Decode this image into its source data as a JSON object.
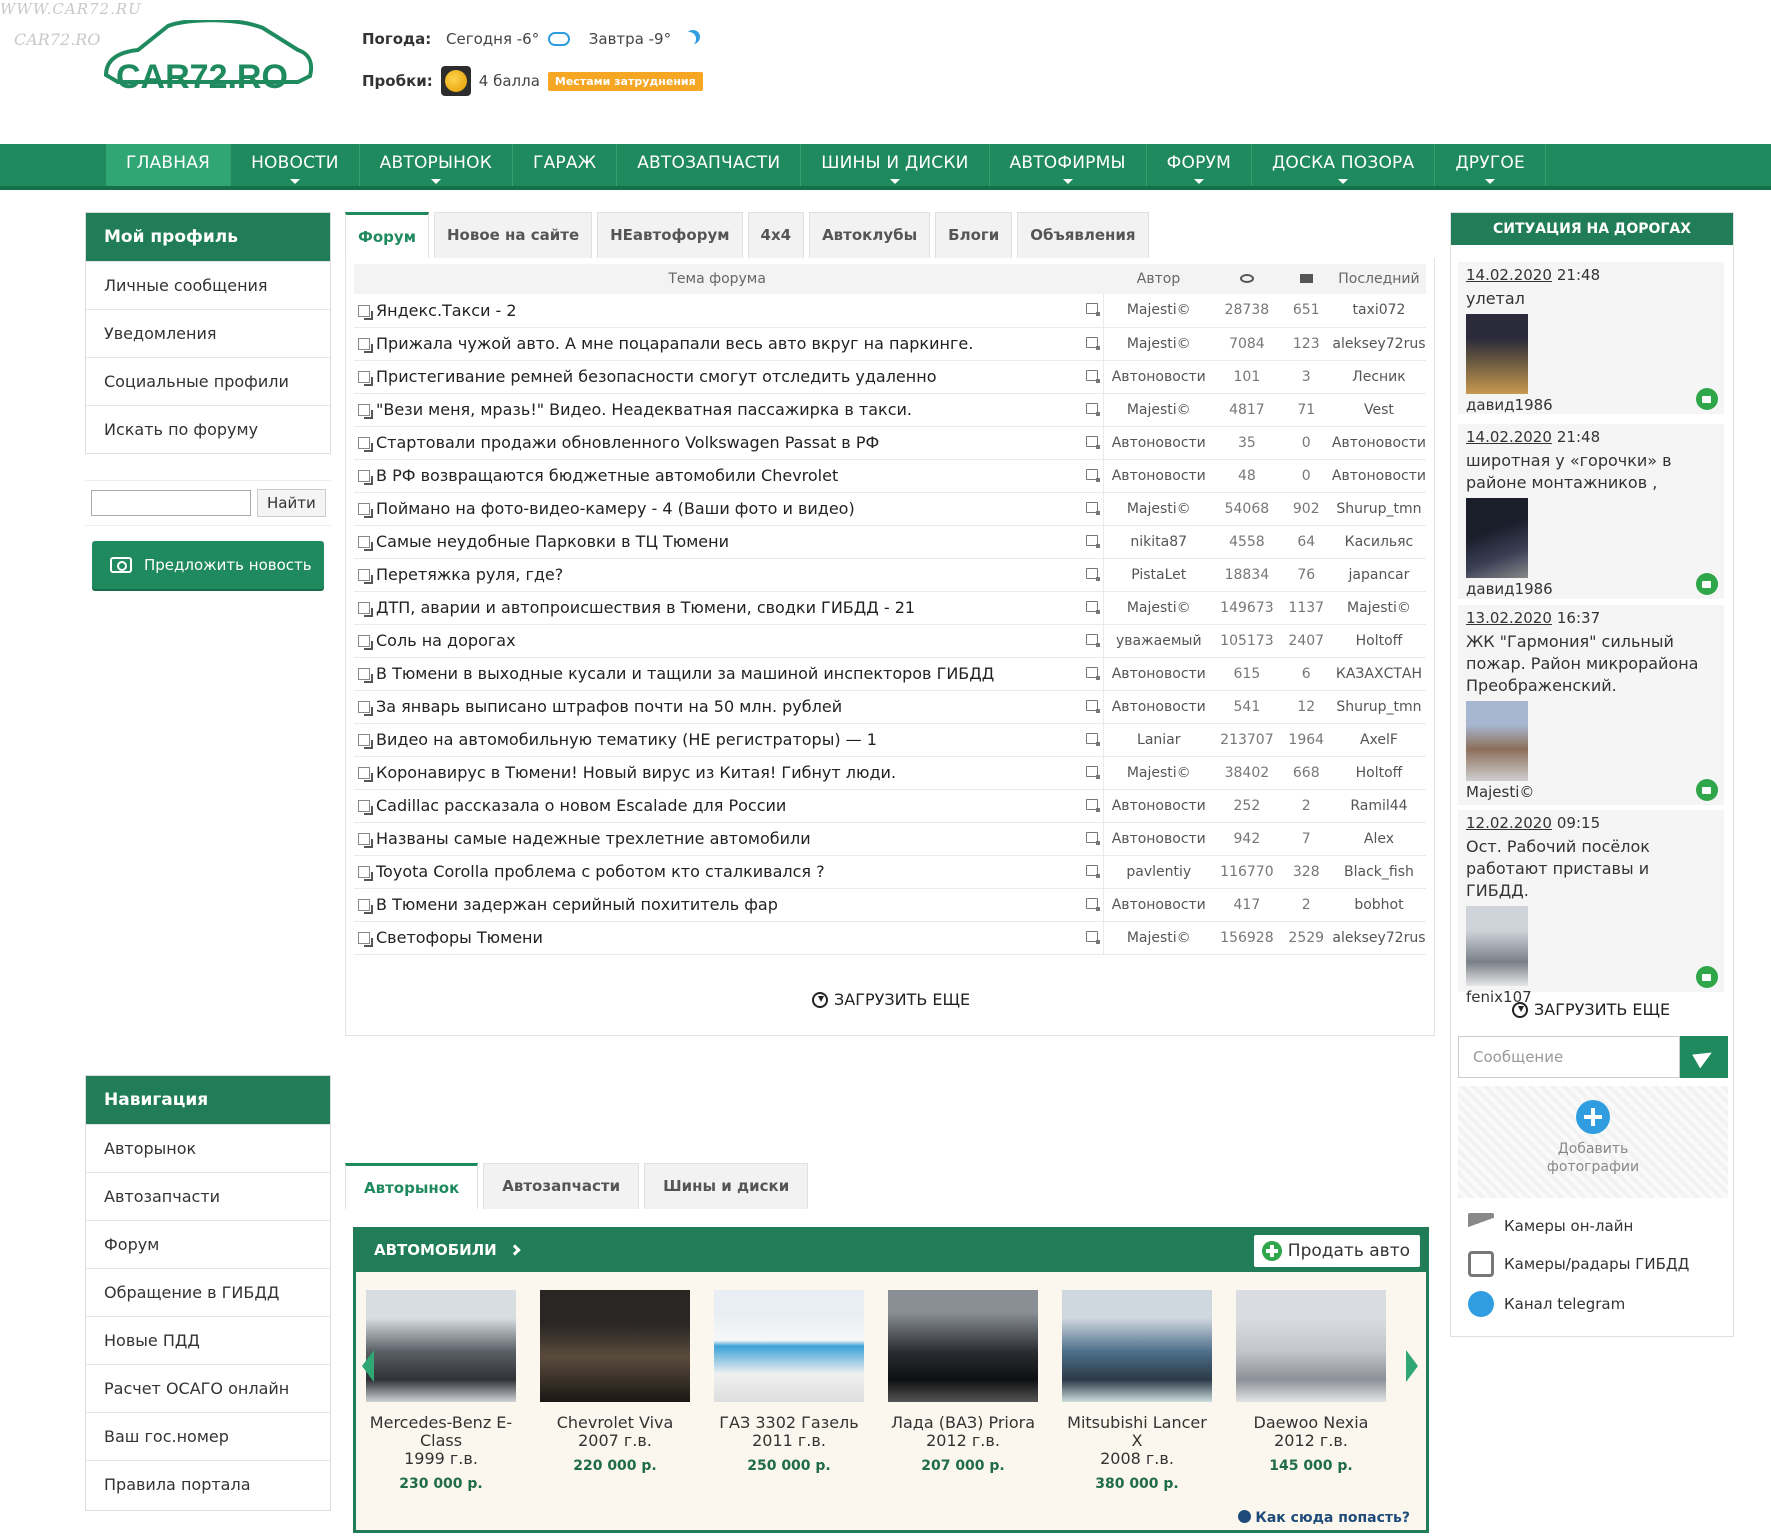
{
  "site": {
    "watermark": "WWW.CAR72.RU",
    "watermark2": "CAR72.RO",
    "logo": "CAR72.RO"
  },
  "weather": {
    "label": "Погода:",
    "today": "Сегодня -6°",
    "tomorrow": "Завтра -9°"
  },
  "traffic": {
    "label": "Пробки:",
    "score": "4 балла",
    "status": "Местами затруднения"
  },
  "nav": [
    "ГЛАВНАЯ",
    "НОВОСТИ",
    "АВТОРЫНОК",
    "ГАРАЖ",
    "АВТОЗАПЧАСТИ",
    "ШИНЫ И ДИСКИ",
    "АВТОФИРМЫ",
    "ФОРУМ",
    "ДОСКА ПОЗОРА",
    "ДРУГОЕ"
  ],
  "profile": {
    "title": "Мой профиль",
    "items": [
      "Личные сообщения",
      "Уведомления",
      "Социальные профили",
      "Искать по форуму"
    ],
    "search_button": "Найти",
    "suggest_button": "Предложить новость"
  },
  "navigation": {
    "title": "Навигация",
    "items": [
      "Авторынок",
      "Автозапчасти",
      "Форум",
      "Обращение в ГИБДД",
      "Новые ПДД",
      "Расчет ОСАГО онлайн",
      "Ваш гос.номер",
      "Правила портала"
    ]
  },
  "forum_tabs": [
    "Форум",
    "Новое на сайте",
    "НЕавтофорум",
    "4x4",
    "Автоклубы",
    "Блоги",
    "Объявления"
  ],
  "forum": {
    "headers": {
      "topic": "Тема форума",
      "author": "Автор",
      "last": "Последний"
    },
    "rows": [
      {
        "t": "Яндекс.Такси - 2",
        "a": "Majesti©",
        "v": "28738",
        "c": "651",
        "l": "taxi072"
      },
      {
        "t": "Прижала чужой авто. А мне поцарапали весь авто вкруг на паркинге.",
        "a": "Majesti©",
        "v": "7084",
        "c": "123",
        "l": "aleksey72rus"
      },
      {
        "t": "Пристегивание ремней безопасности смогут отследить удаленно",
        "a": "Автоновости",
        "v": "101",
        "c": "3",
        "l": "Лесник"
      },
      {
        "t": "\"Вези меня, мразь!\" Видео. Неадекватная пассажирка в такси.",
        "a": "Majesti©",
        "v": "4817",
        "c": "71",
        "l": "Vest"
      },
      {
        "t": "Стартовали продажи обновленного Volkswagen Passat в РФ",
        "a": "Автоновости",
        "v": "35",
        "c": "0",
        "l": "Автоновости"
      },
      {
        "t": "В РФ возвращаются бюджетные автомобили Chevrolet",
        "a": "Автоновости",
        "v": "48",
        "c": "0",
        "l": "Автоновости"
      },
      {
        "t": "Поймано на фото-видео-камеру - 4 (Ваши фото и видео)",
        "a": "Majesti©",
        "v": "54068",
        "c": "902",
        "l": "Shurup_tmn"
      },
      {
        "t": "Самые неудобные Парковки в ТЦ Тюмени",
        "a": "nikita87",
        "v": "4558",
        "c": "64",
        "l": "Касильяс"
      },
      {
        "t": "Перетяжка руля, где?",
        "a": "PistaLet",
        "v": "18834",
        "c": "76",
        "l": "japancar"
      },
      {
        "t": "ДТП, аварии и автопроисшествия в Тюмени, сводки ГИБДД - 21",
        "a": "Majesti©",
        "v": "149673",
        "c": "1137",
        "l": "Majesti©"
      },
      {
        "t": "Соль на дорогах",
        "a": "уважаемый",
        "v": "105173",
        "c": "2407",
        "l": "Holtoff"
      },
      {
        "t": "В Тюмени в выходные кусали и тащили за машиной инспекторов ГИБДД",
        "a": "Автоновости",
        "v": "615",
        "c": "6",
        "l": "КАЗАХСТАН"
      },
      {
        "t": "За январь выписано штрафов почти на 50 млн. рублей",
        "a": "Автоновости",
        "v": "541",
        "c": "12",
        "l": "Shurup_tmn"
      },
      {
        "t": "Видео на автомобильную тематику (НЕ регистраторы) — 1",
        "a": "Laniar",
        "v": "213707",
        "c": "1964",
        "l": "AxelF"
      },
      {
        "t": "Коронавирус в Тюмени! Новый вирус из Китая! Гибнут люди.",
        "a": "Majesti©",
        "v": "38402",
        "c": "668",
        "l": "Holtoff"
      },
      {
        "t": "Cadillac рассказала о новом Escalade для России",
        "a": "Автоновости",
        "v": "252",
        "c": "2",
        "l": "Ramil44"
      },
      {
        "t": "Названы самые надежные трехлетние автомобили",
        "a": "Автоновости",
        "v": "942",
        "c": "7",
        "l": "Alex"
      },
      {
        "t": "Toyota Corolla проблема с роботом кто сталкивался ?",
        "a": "pavlentiy",
        "v": "116770",
        "c": "328",
        "l": "Black_fish"
      },
      {
        "t": "В Тюмени задержан серийный похититель фар",
        "a": "Автоновости",
        "v": "417",
        "c": "2",
        "l": "bobhot"
      },
      {
        "t": "Светофоры Тюмени",
        "a": "Majesti©",
        "v": "156928",
        "c": "2529",
        "l": "aleksey72rus"
      }
    ],
    "load_more": "ЗАГРУЗИТЬ ЕЩЕ"
  },
  "roads": {
    "title": "СИТУАЦИЯ НА ДОРОГАХ",
    "posts": [
      {
        "date": "14.02.2020",
        "time": "21:48",
        "text": "улетал",
        "user": "давид1986"
      },
      {
        "date": "14.02.2020",
        "time": "21:48",
        "text": "широтная у «горочки» в районе монтажников ,",
        "user": "давид1986"
      },
      {
        "date": "13.02.2020",
        "time": "16:37",
        "text": "ЖК \"Гармония\" сильный пожар. Район микрорайона Преображенский.",
        "user": "Majesti©"
      },
      {
        "date": "12.02.2020",
        "time": "09:15",
        "text": "Ост. Рабочий посёлок работают приставы и ГИБДД.",
        "user": "fenix107"
      }
    ],
    "load_more": "ЗАГРУЗИТЬ ЕЩЕ",
    "message_placeholder": "Сообщение",
    "add_photo": "Добавить фотографии",
    "links": [
      "Камеры он-лайн",
      "Камеры/радары ГИБДД",
      "Канал telegram"
    ]
  },
  "market_tabs": [
    "Авторынок",
    "Автозапчасти",
    "Шины и диски"
  ],
  "market": {
    "title": "АВТОМОБИЛИ",
    "sell": "Продать авто",
    "howto": "Как сюда попасть?",
    "cars": [
      {
        "name": "Mercedes-Benz E-Class",
        "year": "1999 г.в.",
        "price": "230 000 р."
      },
      {
        "name": "Chevrolet Viva",
        "year": "2007 г.в.",
        "price": "220 000 р."
      },
      {
        "name": "ГАЗ 3302 Газель",
        "year": "2011 г.в.",
        "price": "250 000 р."
      },
      {
        "name": "Лада (ВАЗ) Priora",
        "year": "2012 г.в.",
        "price": "207 000 р."
      },
      {
        "name": "Mitsubishi Lancer X",
        "year": "2008 г.в.",
        "price": "380 000 р."
      },
      {
        "name": "Daewoo Nexia",
        "year": "2012 г.в.",
        "price": "145 000 р."
      }
    ]
  },
  "colors": {
    "brand": "#1f8a5e",
    "accent": "#f5a623"
  }
}
